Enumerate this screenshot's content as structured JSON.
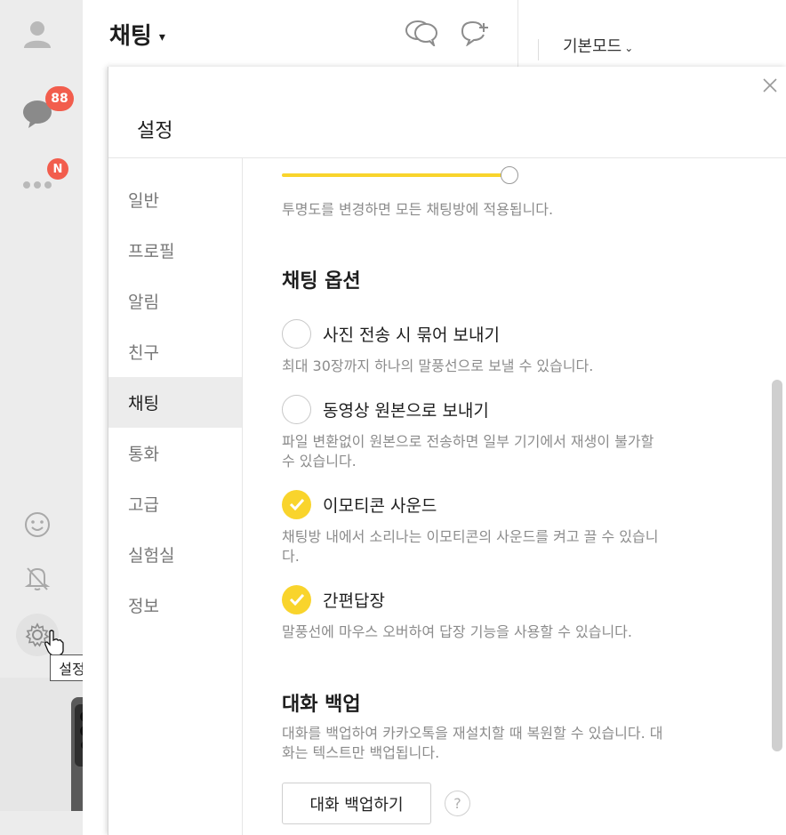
{
  "sidebar": {
    "chat_badge": "88",
    "more_badge": "N",
    "settings_tooltip": "설정"
  },
  "chat_header": {
    "title": "채팅",
    "caret": "▾"
  },
  "right_panel": {
    "mode_label": "기본모드",
    "mode_caret": "⌄"
  },
  "settings": {
    "title": "설정",
    "nav": [
      {
        "label": "일반"
      },
      {
        "label": "프로필"
      },
      {
        "label": "알림"
      },
      {
        "label": "친구"
      },
      {
        "label": "채팅"
      },
      {
        "label": "통화"
      },
      {
        "label": "고급"
      },
      {
        "label": "실험실"
      },
      {
        "label": "정보"
      }
    ],
    "active_nav": "채팅",
    "transparency_slider_value": 1.0,
    "transparency_hint": "투명도를 변경하면 모든 채팅방에 적용됩니다.",
    "chat_options_title": "채팅 옵션",
    "options": [
      {
        "label": "사진 전송 시 묶어 보내기",
        "checked": false,
        "desc": "최대 30장까지 하나의 말풍선으로 보낼 수 있습니다."
      },
      {
        "label": "동영상 원본으로 보내기",
        "checked": false,
        "desc_line1": "파일 변환없이 원본으로 전송하면 일부 기기에서 재생이 불가할",
        "desc_line2": "수 있습니다."
      },
      {
        "label": "이모티콘 사운드",
        "checked": true,
        "desc_line1": "채팅방 내에서 소리나는 이모티콘의 사운드를 켜고 끌 수 있습니",
        "desc_line2": "다."
      },
      {
        "label": "간편답장",
        "checked": true,
        "desc": "말풍선에 마우스 오버하여 답장 기능을 사용할 수 있습니다."
      }
    ],
    "backup_title": "대화 백업",
    "backup_desc_line1": "대화를 백업하여 카카오톡을 재설치할 때 복원할 수 있습니다. 대",
    "backup_desc_line2": "화는 텍스트만 백업됩니다.",
    "backup_button": "대화 백업하기",
    "help_label": "?"
  },
  "colors": {
    "accent": "#f9d42c",
    "badge": "#f25d4d",
    "rail": "#ececec"
  }
}
